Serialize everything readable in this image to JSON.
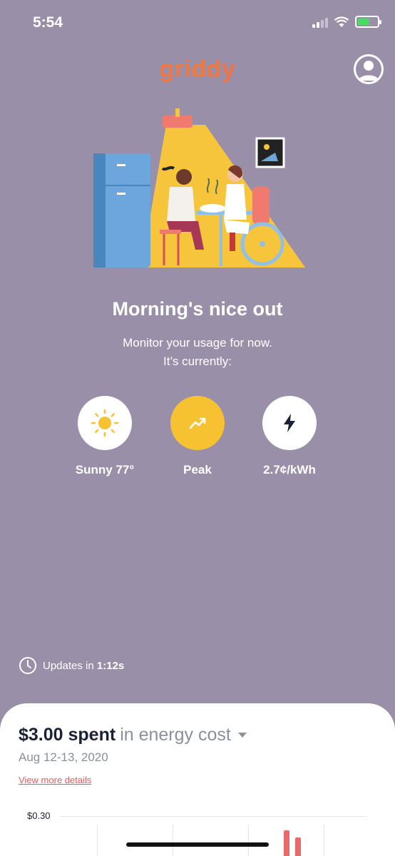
{
  "status_bar": {
    "time": "5:54"
  },
  "app": {
    "logo_text": "griddy"
  },
  "hero": {
    "headline": "Morning's nice out",
    "subtext_line1": "Monitor your usage for now.",
    "subtext_line2": "It’s currently:"
  },
  "stats": [
    {
      "label": "Sunny 77°",
      "icon": "sun-icon"
    },
    {
      "label": "Peak",
      "icon": "trending-up-icon"
    },
    {
      "label": "2.7¢/kWh",
      "icon": "lightning-bolt-icon"
    }
  ],
  "updates": {
    "prefix": "Updates in ",
    "countdown": "1:12s"
  },
  "cost_card": {
    "amount": "$3.00 spent",
    "suffix": "in energy cost",
    "date_range": "Aug 12-13, 2020",
    "details_link": "View more details"
  },
  "chart_data": {
    "type": "bar",
    "y_ticks": [
      "$0.30"
    ]
  },
  "colors": {
    "background": "#9a8fa8",
    "accent": "#e85a5a",
    "peak": "#f6c232",
    "sun": "#f6c232"
  }
}
